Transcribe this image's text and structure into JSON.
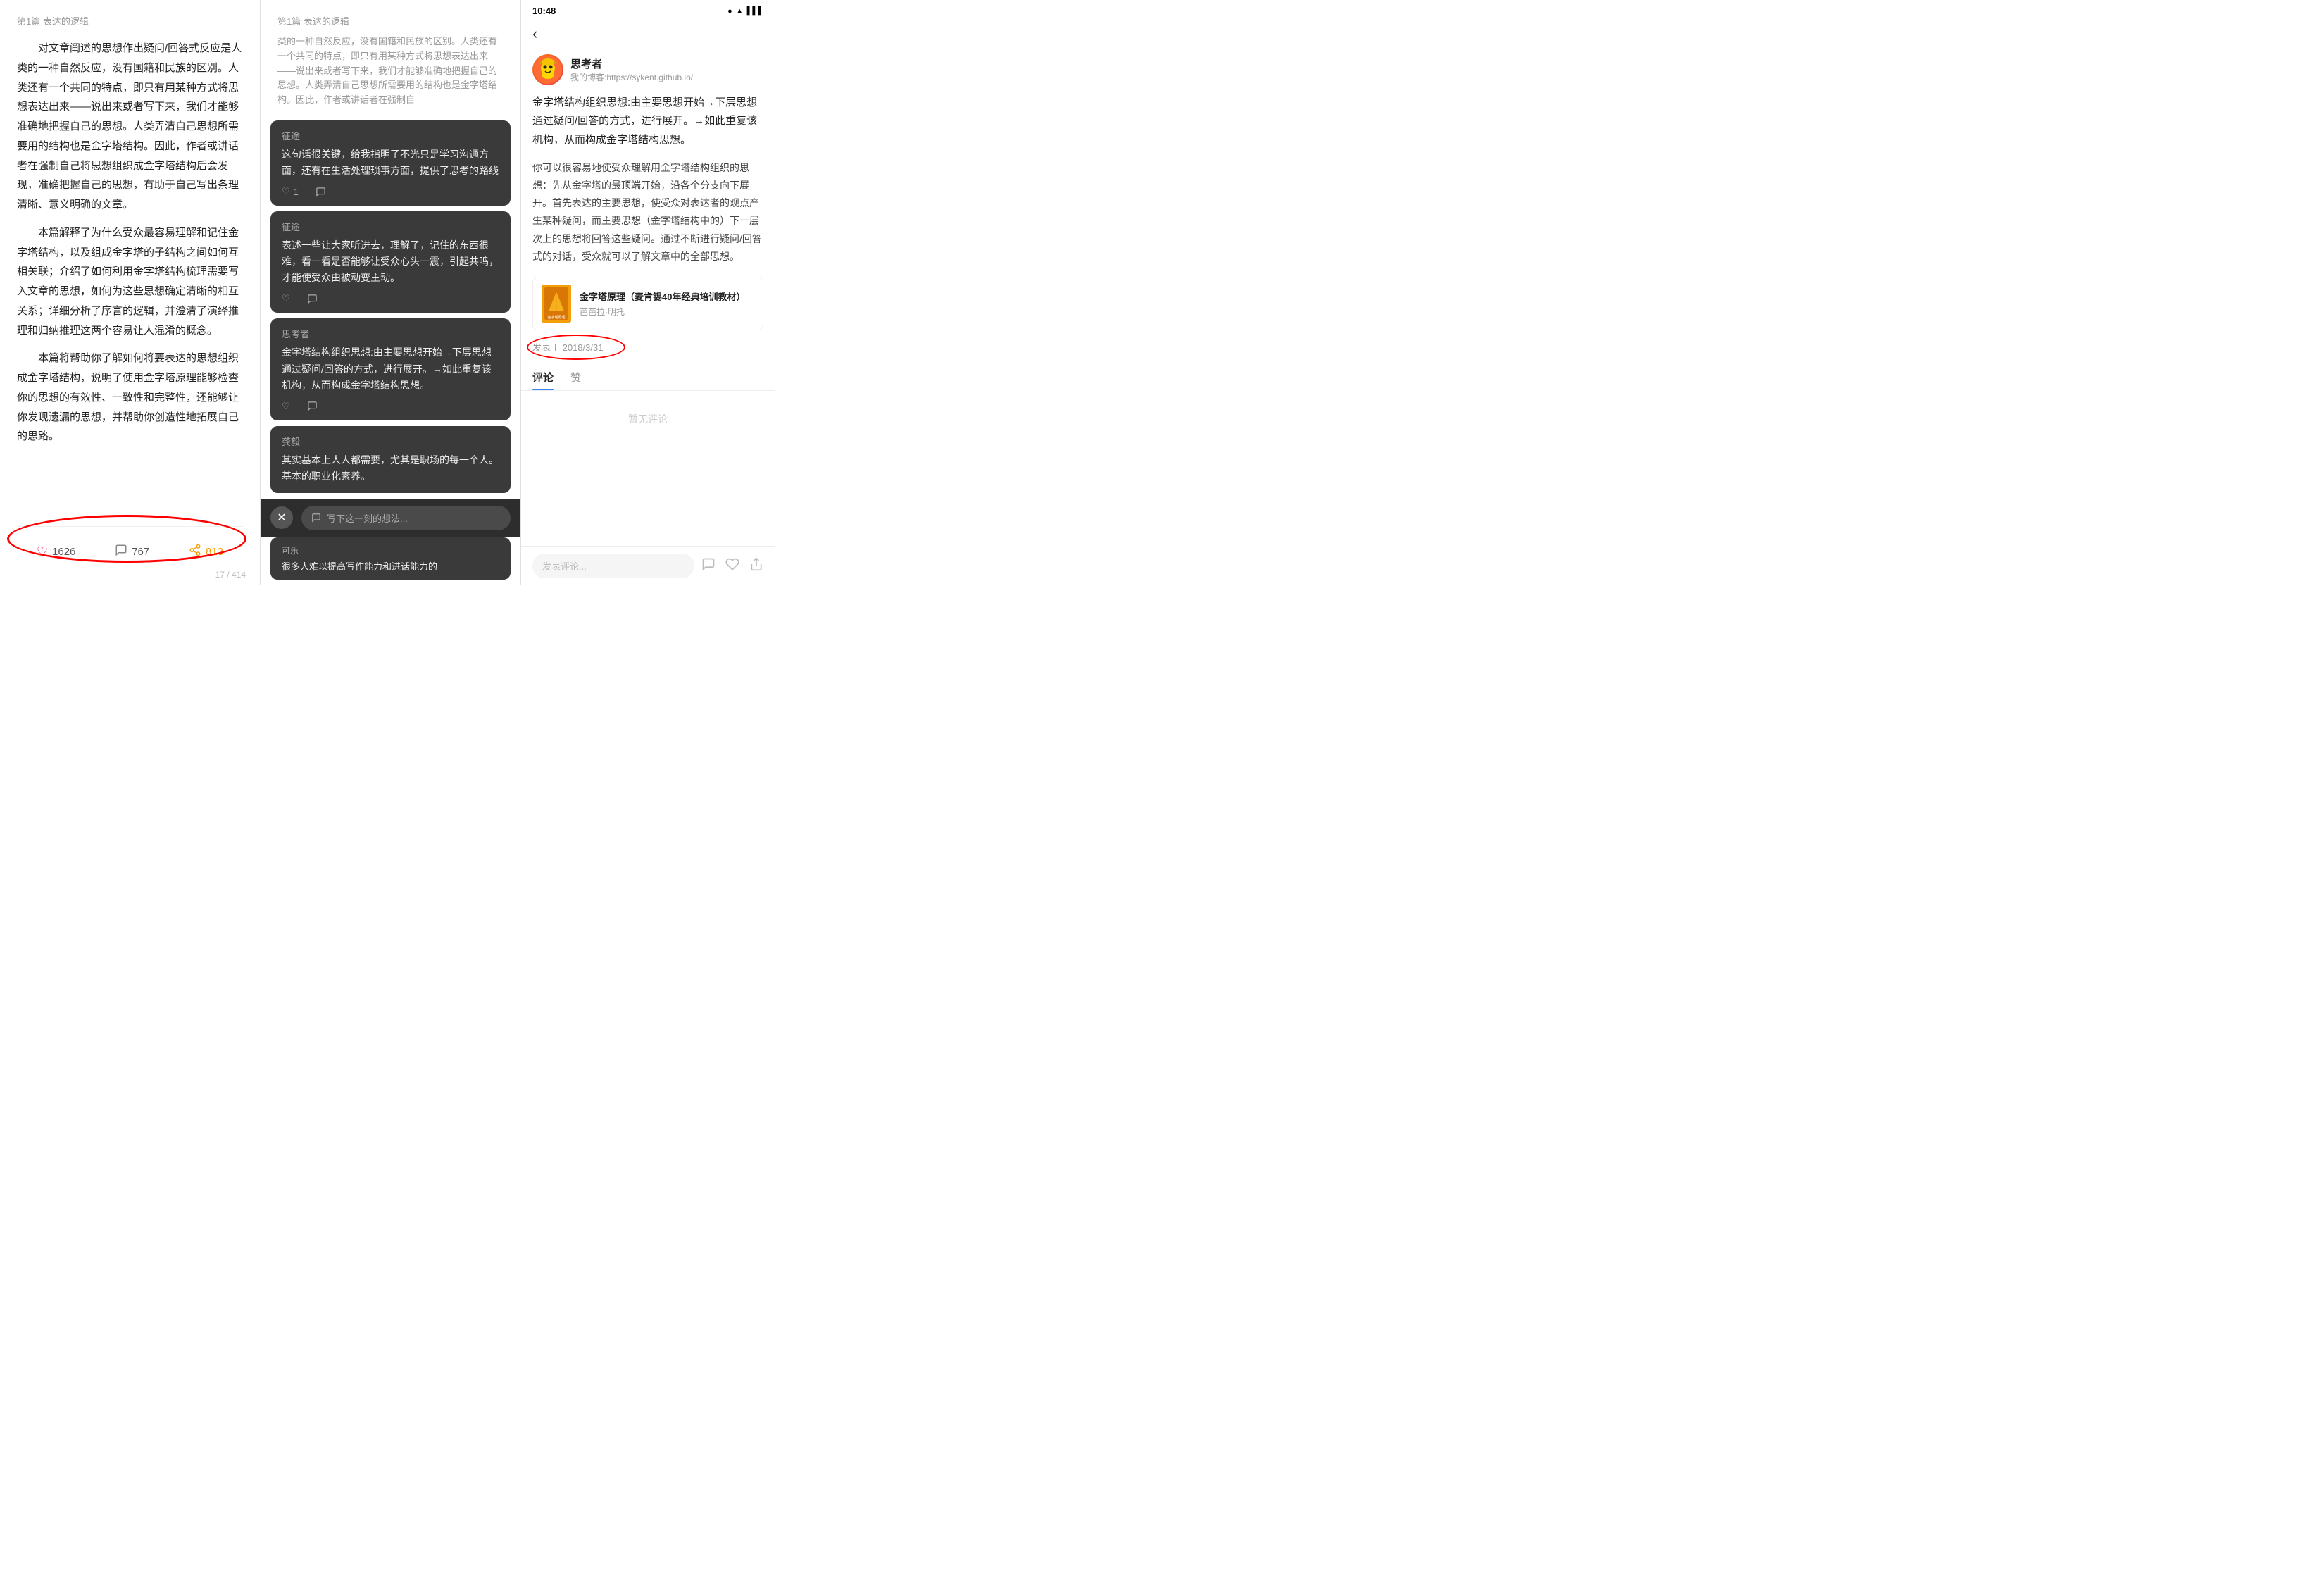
{
  "panel1": {
    "header": "第1篇 表达的逻辑",
    "paragraphs": [
      "对文章阐述的思想作出疑问/回答式反应是人类的一种自然反应，没有国籍和民族的区别。人类还有一个共同的特点，即只有用某种方式将思想表达出来——说出来或者写下来，我们才能够准确地把握自己的思想。人类弄清自己思想所需要用的结构也是金字塔结构。因此，作者或讲话者在强制自己将思想组织成金字塔结构后会发现，准确把握自己的思想，有助于自己写出条理清晰、意义明确的文章。",
      "本篇解释了为什么受众最容易理解和记住金字塔结构，以及组成金字塔的子结构之间如何互相关联；介绍了如何利用金字塔结构梳理需要写入文章的思想，如何为这些思想确定清晰的相互关系；详细分析了序言的逻辑，并澄清了演绎推理和归纳推理这两个容易让人混淆的概念。",
      "本篇将帮助你了解如何将要表达的思想组织成金字塔结构，说明了使用金字塔原理能够检查你的思想的有效性、一致性和完整性，还能够让你发现遗漏的思想，并帮助你创造性地拓展自己的思路。"
    ],
    "like_count": "1626",
    "comment_count": "767",
    "share_count": "813",
    "page_num": "17 / 414"
  },
  "panel2": {
    "header": "第1篇 表达的逻辑",
    "bg_text_snippet": "类的一种自然反应，没有国籍和民族的区别。人类还有一个共同的特点，即只有用某种方式将思想表达出来——说出来或者写下来，我们才能够准确地把握自己的思想。人类弄清自己思想所需要用的结构也是金字塔结构。因此，作者或讲话者在强制自",
    "comments": [
      {
        "user": "征途",
        "text": "这句话很关键，给我指明了不光只是学习沟通方面，还有在生活处理琐事方面，提供了思考的路线",
        "likes": "1",
        "has_reply": false
      },
      {
        "user": "征途",
        "text": "表述一些让大家听进去，理解了，记住的东西很难，看一看是否能够让受众心头一震，引起共鸣，才能使受众由被动变主动。",
        "likes": "",
        "has_reply": false
      },
      {
        "user": "思考者",
        "text": "金字塔结构组织思想:由主要思想开始→下层思想通过疑问/回答的方式，进行展开。→如此重复该机构，从而构成金字塔结构思想。",
        "likes": "",
        "has_reply": false
      },
      {
        "user": "龚毅",
        "text": "其实基本上人人都需要，尤其是职场的每一个人。基本的职业化素养。",
        "likes": "",
        "has_reply": false
      }
    ],
    "partial_user": "可乐",
    "partial_text": "很多人难以提高写作能力和进话能力的",
    "write_placeholder": "写下这一刻的想法..."
  },
  "panel3": {
    "status_bar": {
      "time": "10:48"
    },
    "author": {
      "name": "思考者",
      "blog": "我的博客:https://sykent.github.io/"
    },
    "article": {
      "title": "金字塔结构组织思想:由主要思想开始→下层思想通过疑问/回答的方式，进行展开。→如此重复该机构，从而构成金字塔结构思想。",
      "body": "你可以很容易地使受众理解用金字塔结构组织的思想：先从金字塔的最顶端开始，沿各个分支向下展开。首先表达的主要思想，使受众对表达者的观点产生某种疑问，而主要思想（金字塔结构中的）下一层次上的思想将回答这些疑问。通过不断进行疑问/回答式的对话，受众就可以了解文章中的全部思想。"
    },
    "book": {
      "title": "金字塔原理（麦肯锡40年经典培训教材）",
      "author": "芭芭拉·明托"
    },
    "date": "发表于 2018/3/31",
    "tabs": [
      "评论",
      "赞"
    ],
    "no_comment": "暂无评论",
    "comment_placeholder": "发表评论...",
    "active_tab": "评论"
  }
}
